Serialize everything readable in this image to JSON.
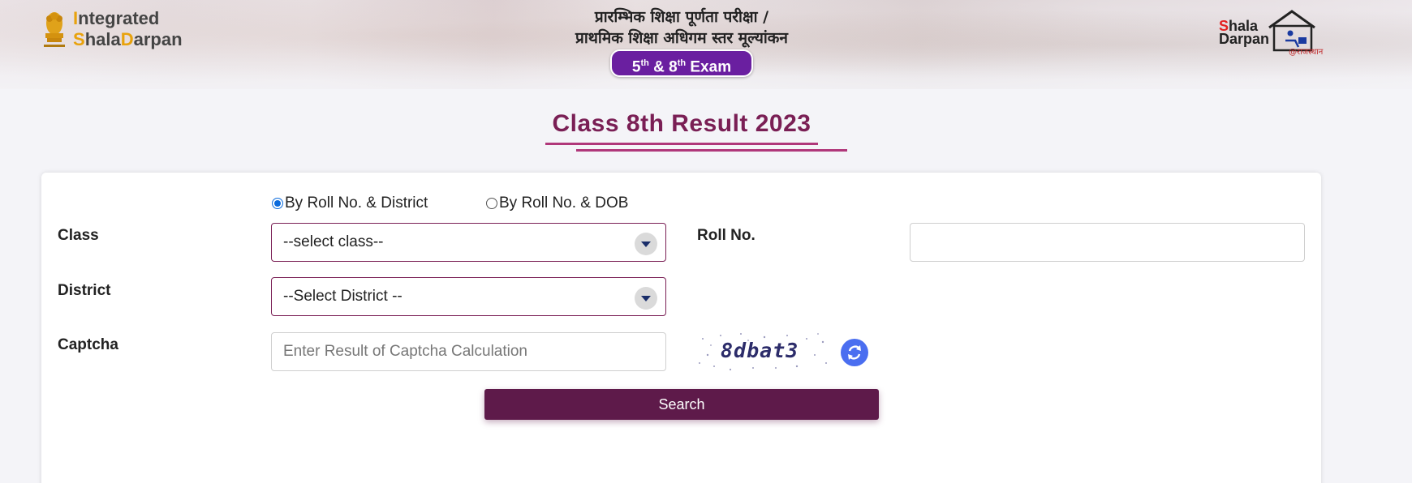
{
  "header": {
    "logo_left": {
      "line1_first": "I",
      "line1_rest": "ntegrated",
      "line2_s": "S",
      "line2_hala": "hala",
      "line2_d": "D",
      "line2_arpan": "arpan"
    },
    "hindi_title_line1": "प्रारम्भिक शिक्षा पूर्णता परीक्षा /",
    "hindi_title_line2": "प्राथमिक शिक्षा अधिगम स्तर मूल्यांकन",
    "exam_pill": {
      "a": "5",
      "a_sup": "th",
      "amp": " & ",
      "b": "8",
      "b_sup": "th",
      "rest": " Exam"
    },
    "logo_right": {
      "s": "S",
      "hala": "hala",
      "darpan": "Darpan",
      "state": "@राजस्थान"
    }
  },
  "page_title": "Class 8th Result 2023",
  "form": {
    "radio_options": [
      {
        "label": "By Roll No. & District",
        "checked": true
      },
      {
        "label": "By Roll No. & DOB",
        "checked": false
      }
    ],
    "class_label": "Class",
    "class_select_value": "--select class--",
    "roll_label": "Roll No.",
    "roll_value": "",
    "district_label": "District",
    "district_select_value": "--Select District --",
    "captcha_label": "Captcha",
    "captcha_placeholder": "Enter Result of Captcha Calculation",
    "captcha_text": "8dbat3",
    "search_label": "Search"
  },
  "colors": {
    "accent": "#7a1f55",
    "button": "#5e1a4a",
    "pill": "#6a1fa0",
    "radio": "#0b6bdc",
    "refresh": "#4a6ef0"
  }
}
